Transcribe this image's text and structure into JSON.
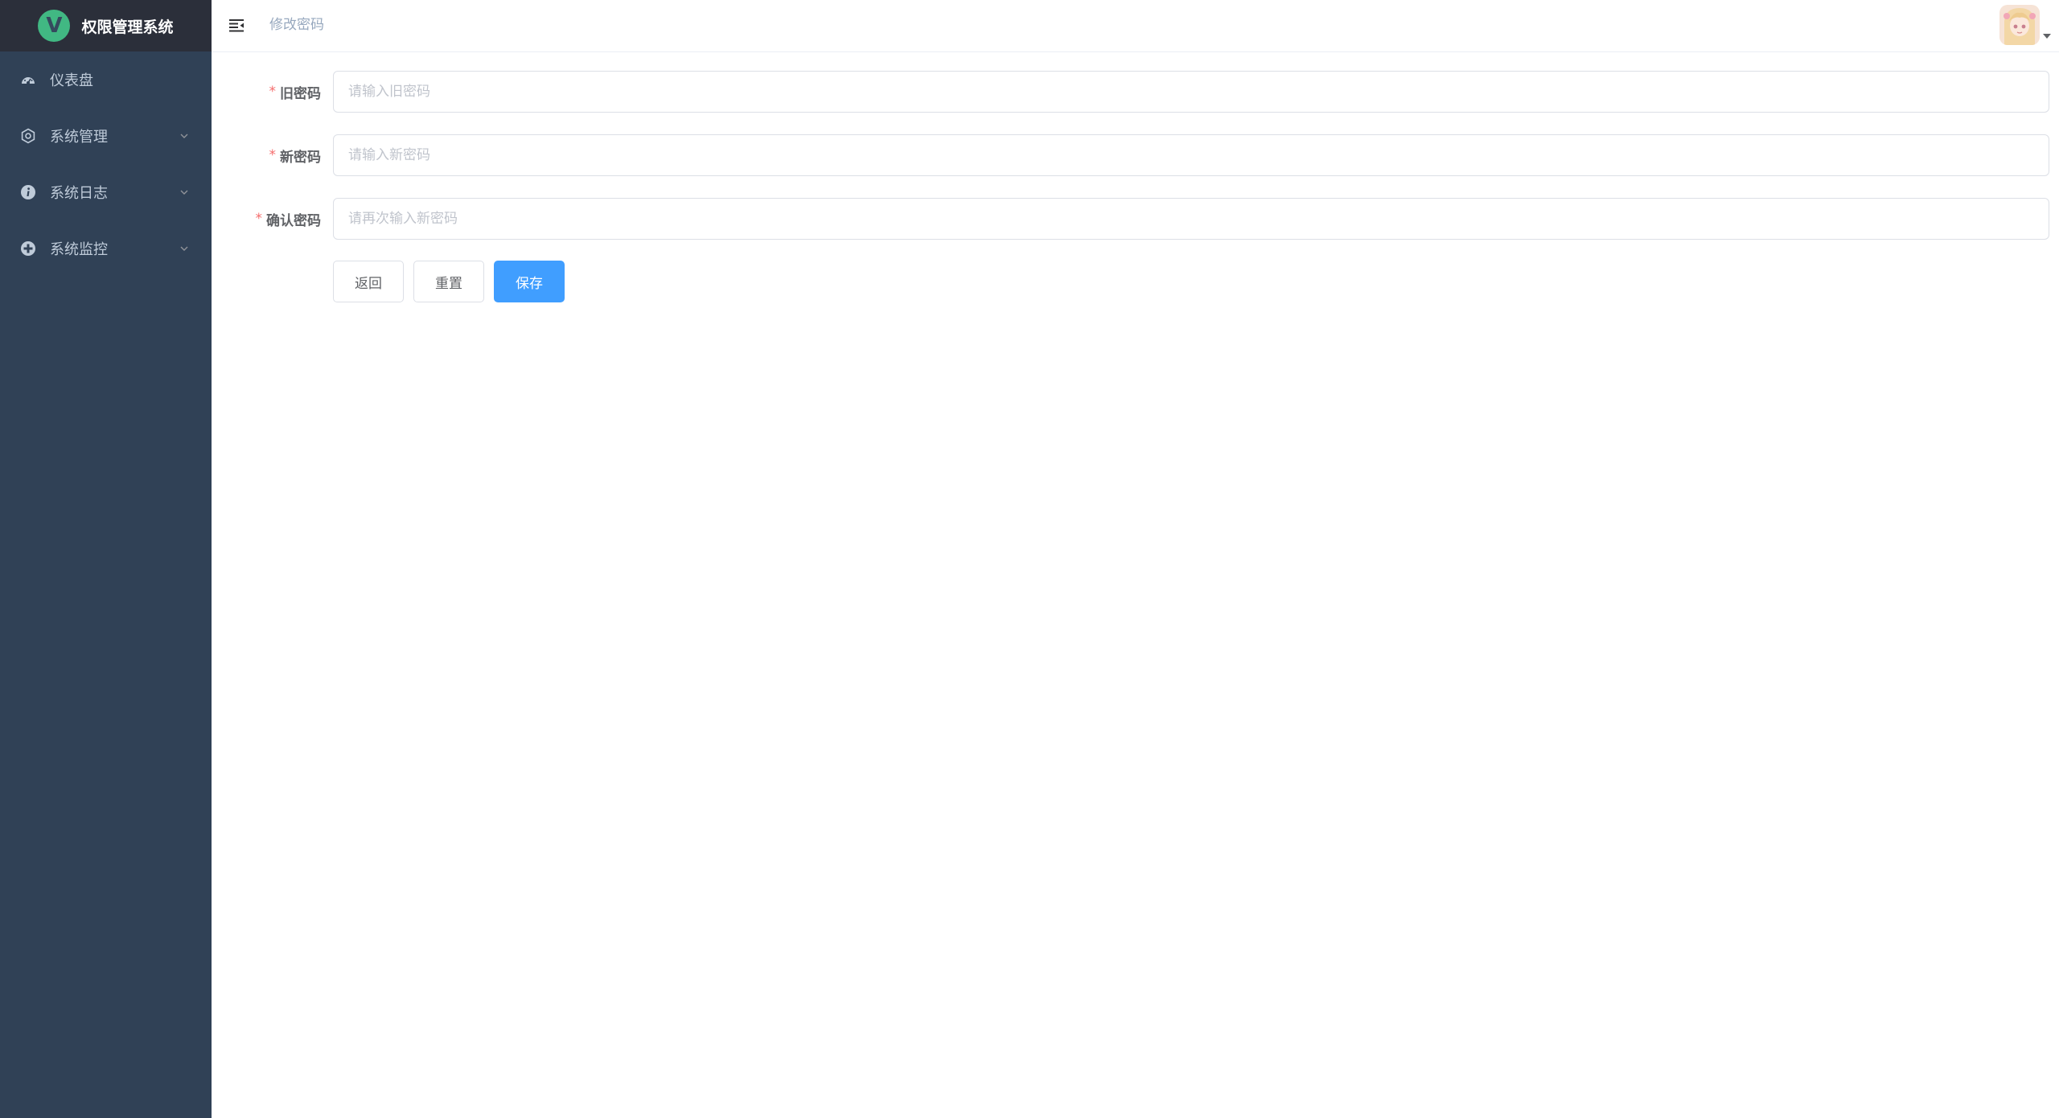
{
  "app": {
    "title": "权限管理系统",
    "logo_letter": "V",
    "logo_color": "#41b883"
  },
  "sidebar": {
    "bg_color": "#304156",
    "items": [
      {
        "label": "仪表盘",
        "icon": "dashboard-icon",
        "has_submenu": false
      },
      {
        "label": "系统管理",
        "icon": "gear-icon",
        "has_submenu": true
      },
      {
        "label": "系统日志",
        "icon": "info-icon",
        "has_submenu": true
      },
      {
        "label": "系统监控",
        "icon": "monitor-icon",
        "has_submenu": true
      }
    ]
  },
  "header": {
    "hamburger_icon": "hamburger-icon",
    "breadcrumb": "修改密码",
    "avatar_icon": "user-avatar-icon"
  },
  "form": {
    "fields": [
      {
        "label": "旧密码",
        "required": true,
        "placeholder": "请输入旧密码",
        "value": ""
      },
      {
        "label": "新密码",
        "required": true,
        "placeholder": "请输入新密码",
        "value": ""
      },
      {
        "label": "确认密码",
        "required": true,
        "placeholder": "请再次输入新密码",
        "value": ""
      }
    ],
    "required_mark": "*",
    "buttons": {
      "back": "返回",
      "reset": "重置",
      "save": "保存"
    }
  },
  "colors": {
    "primary": "#409eff",
    "required": "#f56c6c",
    "menu_text": "#bfcbd9"
  }
}
